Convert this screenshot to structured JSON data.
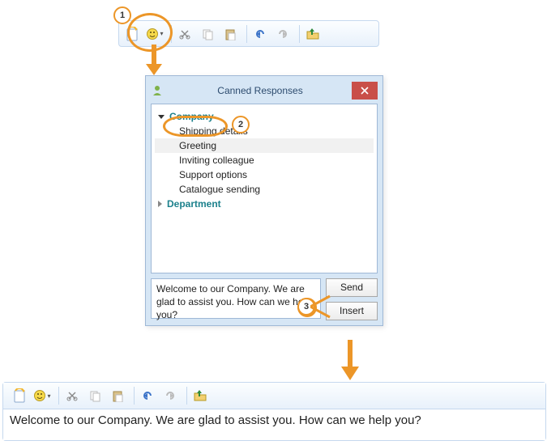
{
  "toolbar": {
    "icons": [
      "canned-response",
      "emoji",
      "cut",
      "copy",
      "paste",
      "undo",
      "redo",
      "send-to"
    ]
  },
  "dialog": {
    "title": "Canned Responses",
    "send_label": "Send",
    "insert_label": "Insert",
    "preview_text": "Welcome to our Company. We are glad to assist you. How can we help you?",
    "tree": {
      "groups": [
        {
          "name": "Company",
          "expanded": true,
          "items": [
            "Shipping details",
            "Greeting",
            "Inviting colleague",
            "Support options",
            "Catalogue sending"
          ],
          "selected": "Greeting"
        },
        {
          "name": "Department",
          "expanded": false,
          "items": []
        }
      ]
    }
  },
  "editor": {
    "text": "Welcome to our Company. We are glad to assist you. How can we help you?"
  },
  "annotations": {
    "step1": "1",
    "step2": "2",
    "step3": "3"
  },
  "colors": {
    "accent": "#ec9628",
    "teal": "#1c818c",
    "close": "#c94f49"
  }
}
